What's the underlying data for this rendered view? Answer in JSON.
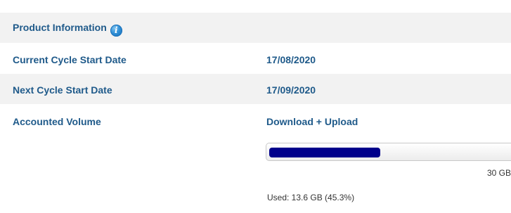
{
  "product_info": {
    "title": "Product Information",
    "info_icon": "info-icon"
  },
  "rows": [
    {
      "label": "Current Cycle Start Date",
      "value": "17/08/2020"
    },
    {
      "label": "Next Cycle Start Date",
      "value": "17/09/2020"
    },
    {
      "label": "Accounted Volume",
      "value": "Download + Upload"
    }
  ],
  "usage": {
    "fraction": 0.453,
    "max_label": "30 GB",
    "used_text": "Used: 13.6 GB (45.3%)"
  },
  "colors": {
    "label_text": "#1f5a8a",
    "row_shaded": "#f2f2f2",
    "progress_fill": "#00008b",
    "info_icon": "#2f8fd6"
  }
}
